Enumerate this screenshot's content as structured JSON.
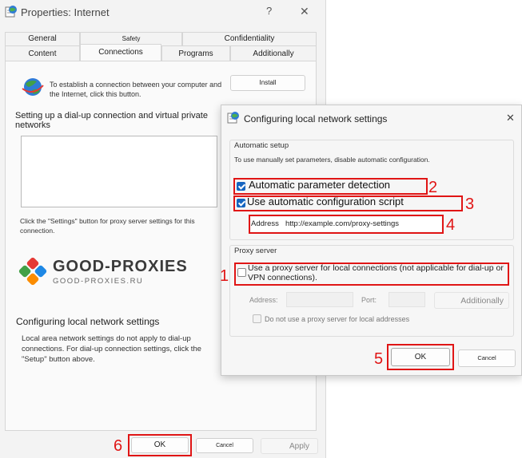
{
  "outer": {
    "title": "Properties: Internet",
    "help": "?",
    "close": "✕",
    "tabs_back": [
      "General",
      "Safety",
      "Confidentiality"
    ],
    "tabs_front": [
      "Content",
      "Connections",
      "Programs",
      "Additionally"
    ],
    "establish_text": "To establish a connection between your computer and the Internet, click this button.",
    "install_label": "Install",
    "dialup_heading": "Setting up a dial-up connection and virtual private networks",
    "settings_hint": "Click the \"Settings\" button for proxy server settings for this connection.",
    "lan_heading": "Configuring local network settings",
    "lan_text": "Local area network settings do not apply to dial-up connections. For dial-up connection settings, click the \"Setup\" button above.",
    "ok_label": "OK",
    "cancel_label": "Cancel",
    "apply_label": "Apply",
    "markers": {
      "ok": "6"
    }
  },
  "watermark": {
    "brand": "GOOD-PROXIES",
    "domain": "GOOD-PROXIES.RU"
  },
  "inner": {
    "title": "Configuring local network settings",
    "close": "✕",
    "auto_setup": {
      "legend": "Automatic setup",
      "hint": "To use manually set parameters, disable automatic configuration.",
      "auto_detect_label": "Automatic parameter detection",
      "auto_detect_checked": true,
      "script_label": "Use automatic configuration script",
      "script_checked": true,
      "address_label": "Address",
      "address_value": "http://example.com/proxy-settings"
    },
    "proxy": {
      "legend": "Proxy server",
      "use_proxy_label": "Use a proxy server for local connections (not applicable for dial-up or VPN connections).",
      "use_proxy_checked": false,
      "address_label": "Address:",
      "port_label": "Port:",
      "additionally_label": "Additionally",
      "bypass_label": "Do not use a proxy server for local addresses",
      "bypass_checked": false
    },
    "ok_label": "OK",
    "cancel_label": "Cancel",
    "markers": {
      "detect": "2",
      "script": "3",
      "address": "4",
      "proxy": "1",
      "ok": "5"
    }
  },
  "colors": {
    "accent": "#1565c0",
    "annotation": "#e01515"
  }
}
